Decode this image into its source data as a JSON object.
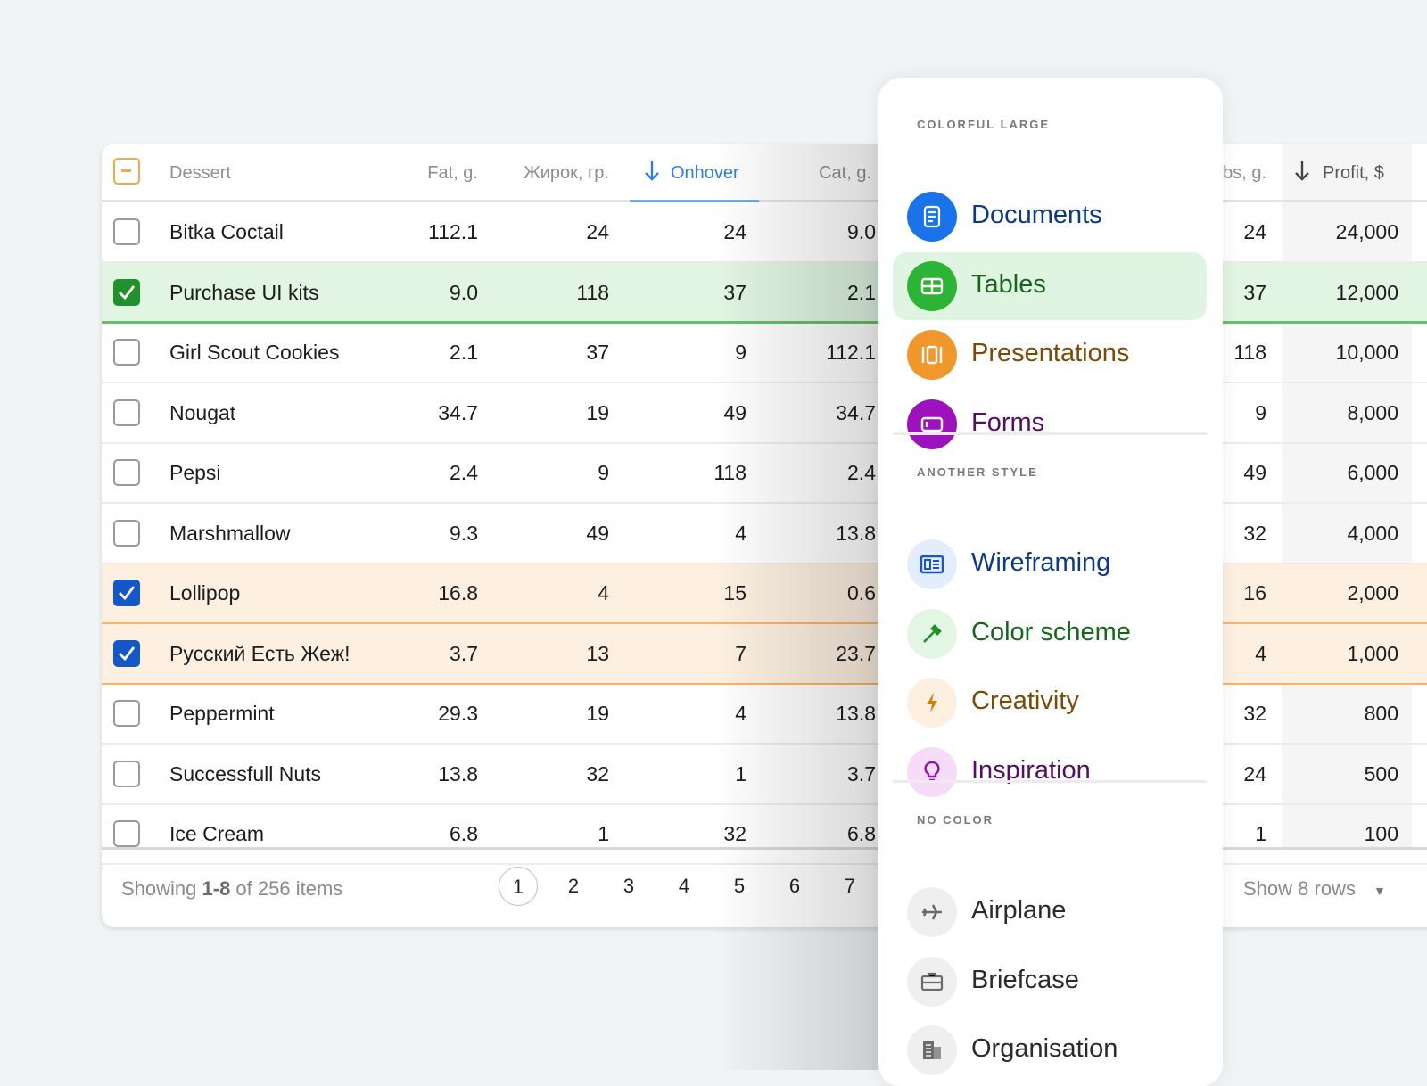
{
  "table": {
    "columns": {
      "dessert": "Dessert",
      "fat": "Fat, g.",
      "zhirok": "Жирок, гр.",
      "onhover": "Onhover",
      "cat": "Cat, g.",
      "carbs": "bs, g.",
      "profit": "Profit, $"
    },
    "rows": [
      {
        "name": "Bitka Coctail",
        "fat": "112.1",
        "zhirok": "24",
        "onhover": "24",
        "cat": "9.0",
        "carbs": "24",
        "profit": "24,000",
        "checked": false,
        "state": ""
      },
      {
        "name": "Purchase UI kits",
        "fat": "9.0",
        "zhirok": "118",
        "onhover": "37",
        "cat": "2.1",
        "carbs": "37",
        "profit": "12,000",
        "checked": true,
        "state": "green"
      },
      {
        "name": "Girl Scout Cookies",
        "fat": "2.1",
        "zhirok": "37",
        "onhover": "9",
        "cat": "112.1",
        "carbs": "118",
        "profit": "10,000",
        "checked": false,
        "state": ""
      },
      {
        "name": "Nougat",
        "fat": "34.7",
        "zhirok": "19",
        "onhover": "49",
        "cat": "34.7",
        "carbs": "9",
        "profit": "8,000",
        "checked": false,
        "state": ""
      },
      {
        "name": "Pepsi",
        "fat": "2.4",
        "zhirok": "9",
        "onhover": "118",
        "cat": "2.4",
        "carbs": "49",
        "profit": "6,000",
        "checked": false,
        "state": ""
      },
      {
        "name": "Marshmallow",
        "fat": "9.3",
        "zhirok": "49",
        "onhover": "4",
        "cat": "13.8",
        "carbs": "32",
        "profit": "4,000",
        "checked": false,
        "state": ""
      },
      {
        "name": "Lollipop",
        "fat": "16.8",
        "zhirok": "4",
        "onhover": "15",
        "cat": "0.6",
        "carbs": "16",
        "profit": "2,000",
        "checked": true,
        "state": "orange"
      },
      {
        "name": "Русский Есть Жеж!",
        "fat": "3.7",
        "zhirok": "13",
        "onhover": "7",
        "cat": "23.7",
        "carbs": "4",
        "profit": "1,000",
        "checked": true,
        "state": "orange"
      },
      {
        "name": "Peppermint",
        "fat": "29.3",
        "zhirok": "19",
        "onhover": "4",
        "cat": "13.8",
        "carbs": "32",
        "profit": "800",
        "checked": false,
        "state": ""
      },
      {
        "name": "Successfull Nuts",
        "fat": "13.8",
        "zhirok": "32",
        "onhover": "1",
        "cat": "3.7",
        "carbs": "24",
        "profit": "500",
        "checked": false,
        "state": ""
      },
      {
        "name": "Ice Cream",
        "fat": "6.8",
        "zhirok": "1",
        "onhover": "32",
        "cat": "6.8",
        "carbs": "1",
        "profit": "100",
        "checked": false,
        "state": ""
      }
    ],
    "footer": {
      "showing_prefix": "Showing ",
      "range": "1-8",
      "showing_suffix": " of 256 items",
      "pages": [
        "1",
        "2",
        "3",
        "4",
        "5",
        "6",
        "7"
      ],
      "current_page": "1",
      "rows_select": "Show 8 rows"
    }
  },
  "menu": {
    "sections": [
      {
        "label": "COLORFUL LARGE",
        "items": [
          {
            "label": "Documents",
            "icon": "document-icon",
            "bg": "#1a73e8",
            "fg": "#0b3a80",
            "glyph": "#fff"
          },
          {
            "label": "Tables",
            "icon": "table-icon",
            "bg": "#2db336",
            "fg": "#1a6420",
            "glyph": "#fff",
            "active": true
          },
          {
            "label": "Presentations",
            "icon": "presentation-icon",
            "bg": "#f0982b",
            "fg": "#7d4a06",
            "glyph": "#fff"
          },
          {
            "label": "Forms",
            "icon": "form-icon",
            "bg": "#9c13bd",
            "fg": "#53105f",
            "glyph": "#fff"
          }
        ]
      },
      {
        "label": "ANOTHER STYLE",
        "items": [
          {
            "label": "Wireframing",
            "icon": "wireframe-icon",
            "bg": "#e3edfb",
            "fg": "#0d3a82",
            "glyph": "#1a55c4"
          },
          {
            "label": "Color scheme",
            "icon": "eyedropper-icon",
            "bg": "#e2f6e3",
            "fg": "#16671d",
            "glyph": "#1f8f27"
          },
          {
            "label": "Creativity",
            "icon": "lightning-icon",
            "bg": "#fdf0e1",
            "fg": "#7a4a07",
            "glyph": "#d47d12"
          },
          {
            "label": "Inspiration",
            "icon": "lightbulb-icon",
            "bg": "#f6dcf8",
            "fg": "#520f63",
            "glyph": "#8d18a8"
          }
        ]
      },
      {
        "label": "NO COLOR",
        "items": [
          {
            "label": "Airplane",
            "icon": "airplane-icon",
            "bg": "#efefef",
            "fg": "#2b2b2b",
            "glyph": "#6b6b6b"
          },
          {
            "label": "Briefcase",
            "icon": "briefcase-icon",
            "bg": "#efefef",
            "fg": "#2b2b2b",
            "glyph": "#6b6b6b"
          },
          {
            "label": "Organisation",
            "icon": "building-icon",
            "bg": "#efefef",
            "fg": "#2b2b2b",
            "glyph": "#6b6b6b"
          }
        ]
      }
    ]
  }
}
